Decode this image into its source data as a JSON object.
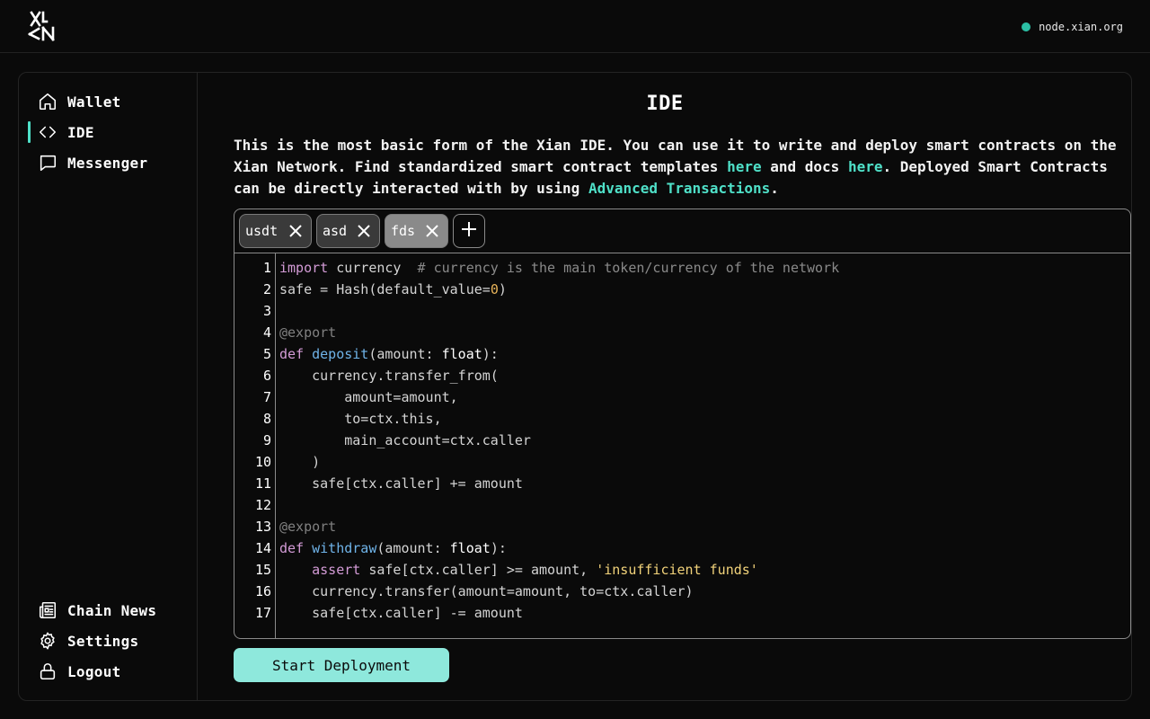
{
  "header": {
    "node_label": "node.xian.org",
    "node_status_color": "#2bbfa4",
    "logo_icon": "xian-logo-icon"
  },
  "sidebar": {
    "items": [
      {
        "label": "Wallet",
        "icon": "home-icon"
      },
      {
        "label": "IDE",
        "icon": "code-brackets-icon",
        "active": true
      },
      {
        "label": "Messenger",
        "icon": "chat-bubble-icon"
      }
    ],
    "bottom_items": [
      {
        "label": "Chain News",
        "icon": "newspaper-icon"
      },
      {
        "label": "Settings",
        "icon": "gear-icon"
      },
      {
        "label": "Logout",
        "icon": "lock-icon"
      }
    ],
    "accent_color": "#4fe0c8"
  },
  "main": {
    "title": "IDE",
    "intro": {
      "part1": "This is the most basic form of the Xian IDE. You can use it to write and deploy smart contracts on the Xian Network. Find standardized smart contract templates ",
      "link1": "here",
      "part2": " and docs ",
      "link2": "here",
      "part3": ". Deployed Smart Contracts can be directly interacted with by using ",
      "link3": "Advanced Transactions",
      "part4": "."
    },
    "tabs": [
      {
        "label": "usdt",
        "active": false
      },
      {
        "label": "asd",
        "active": false
      },
      {
        "label": "fds",
        "active": true
      }
    ],
    "code_lines": [
      "import currency  # currency is the main token/currency of the network",
      "safe = Hash(default_value=0)",
      "",
      "@export",
      "def deposit(amount: float):",
      "    currency.transfer_from(",
      "        amount=amount,",
      "        to=ctx.this,",
      "        main_account=ctx.caller",
      "    )",
      "    safe[ctx.caller] += amount",
      "",
      "@export",
      "def withdraw(amount: float):",
      "    assert safe[ctx.caller] >= amount, 'insufficient funds'",
      "    currency.transfer(amount=amount, to=ctx.caller)",
      "    safe[ctx.caller] -= amount"
    ],
    "deploy_label": "Start Deployment"
  }
}
